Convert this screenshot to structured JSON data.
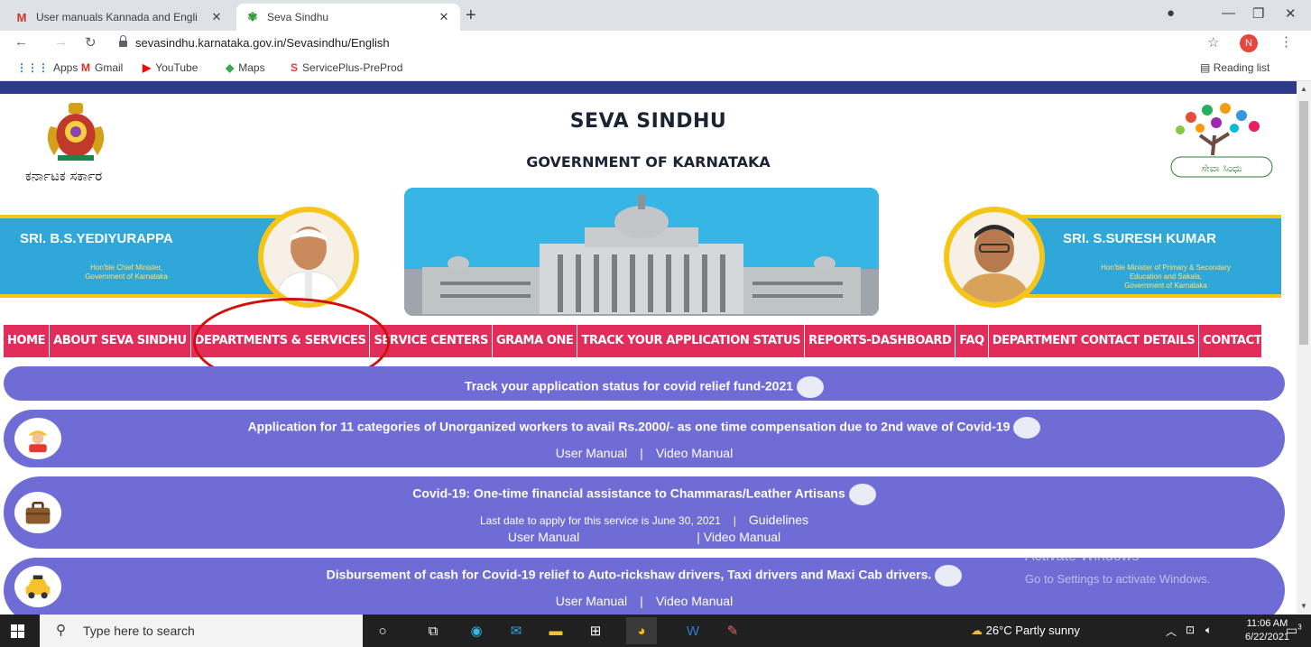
{
  "browser": {
    "tabs": [
      {
        "title": "User manuals Kannada and Engli",
        "favicon": "gmail-icon"
      },
      {
        "title": "Seva Sindhu",
        "favicon": "seva-sindhu-icon"
      }
    ],
    "url": "sevasindhu.karnataka.gov.in/Sevasindhu/English",
    "profile_initial": "N",
    "bookmarks": [
      "Apps",
      "Gmail",
      "YouTube",
      "Maps",
      "ServicePlus-PreProd"
    ],
    "reading_list": "Reading list"
  },
  "header": {
    "kannada_text": "ಕರ್ನಾಟಕ ಸರ್ಕಾರ",
    "title": "SEVA SINDHU",
    "subtitle": "GOVERNMENT OF KARNATAKA",
    "tree_logo_text": "ಸೇವಾ ಸಿಂಧು"
  },
  "banners": {
    "left": {
      "name": "SRI. B.S.YEDIYURAPPA",
      "role": "Hon'ble Chief Minister,\nGovernment of Karnataka"
    },
    "right": {
      "name": "SRI. S.SURESH KUMAR",
      "role": "Hon'ble Minister of Primary & Secondary\nEducation and Sakala,\nGovernment of Karnataka"
    }
  },
  "nav": [
    "HOME",
    "ABOUT SEVA SINDHU",
    "DEPARTMENTS & SERVICES",
    "SERVICE CENTERS",
    "GRAMA ONE",
    "TRACK YOUR APPLICATION STATUS",
    "REPORTS-DASHBOARD",
    "FAQ",
    "DEPARTMENT CONTACT DETAILS",
    "CONTACT"
  ],
  "cards": {
    "track": "Track your application status for covid relief fund-2021",
    "unorganized": {
      "title": "Application for 11 categories of Unorganized workers to avail Rs.2000/- as one time compensation due to 2nd wave of Covid-19",
      "user_manual": "User Manual",
      "separator": "|",
      "video_manual": "Video Manual"
    },
    "chammaras": {
      "title": "Covid-19: One-time financial assistance to Chammaras/Leather Artisans",
      "last_date": "Last date to apply for this service is June 30, 2021",
      "separator": "|",
      "guidelines": "Guidelines",
      "user_manual": "User Manual",
      "video_manual": "| Video Manual"
    },
    "auto": {
      "title": "Disbursement of cash for Covid-19 relief to Auto-rickshaw drivers, Taxi drivers and Maxi Cab drivers.",
      "user_manual": "User Manual",
      "separator": "|",
      "video_manual": "Video Manual"
    }
  },
  "watermark": {
    "line1": "Activate Windows",
    "line2": "Go to Settings to activate Windows."
  },
  "taskbar": {
    "search_placeholder": "Type here to search",
    "weather": "26°C  Partly sunny",
    "time": "11:06 AM",
    "date": "6/22/2021",
    "notifications": "3"
  },
  "colors": {
    "nav_bg": "#e22d5a",
    "card_bg": "#6f6cd6",
    "banner_bg": "#2fa7d8",
    "banner_border": "#f5c518",
    "highlight_oval": "#d40c0c"
  }
}
